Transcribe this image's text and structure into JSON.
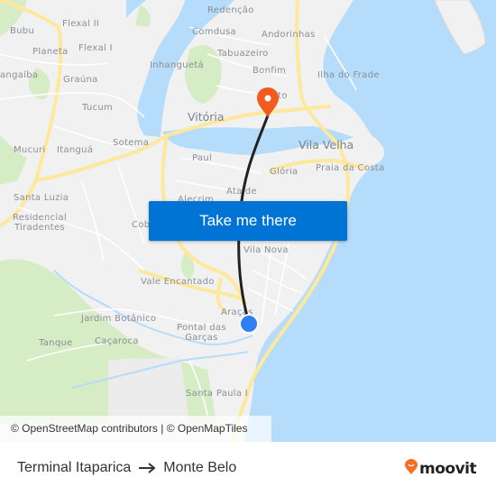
{
  "map": {
    "colors": {
      "land": "#f1f1f1",
      "water": "#b5dcfa",
      "park": "#d6ecc4",
      "major_road": "#fde89c",
      "minor_road": "#ffffff",
      "route_line": "#222222",
      "origin_marker": "#2f7ef3",
      "destination_marker": "#f25a1f"
    },
    "places": [
      {
        "id": "redencao",
        "label": "Redenção"
      },
      {
        "id": "bubu",
        "label": "Bubu"
      },
      {
        "id": "flexal-ii",
        "label": "Flexal II"
      },
      {
        "id": "comdusa",
        "label": "Comdusa"
      },
      {
        "id": "andorinhas",
        "label": "Andorinhas"
      },
      {
        "id": "planeta",
        "label": "Planeta"
      },
      {
        "id": "flexal-i",
        "label": "Flexal I"
      },
      {
        "id": "tabuazeiro",
        "label": "Tabuazeiro"
      },
      {
        "id": "inhangueta",
        "label": "Inhanguetá"
      },
      {
        "id": "bonfim",
        "label": "Bonfim"
      },
      {
        "id": "ilha-do-frade",
        "label": "Ilha do Frade"
      },
      {
        "id": "cangaiba",
        "label": "angaíba"
      },
      {
        "id": "grauna",
        "label": "Graúna"
      },
      {
        "id": "tucum",
        "label": "Tucum"
      },
      {
        "id": "bento",
        "label": "to"
      },
      {
        "id": "vitoria",
        "label": "Vitória"
      },
      {
        "id": "sotema",
        "label": "Sotema"
      },
      {
        "id": "vila-velha",
        "label": "Vila Velha"
      },
      {
        "id": "mucuri",
        "label": "Mucuri"
      },
      {
        "id": "itangua",
        "label": "Itanguá"
      },
      {
        "id": "paul",
        "label": "Paul"
      },
      {
        "id": "gloria",
        "label": "Glória"
      },
      {
        "id": "praia-da-costa",
        "label": "Praia da Costa"
      },
      {
        "id": "santa-luzia",
        "label": "Santa Luzia"
      },
      {
        "id": "ataide",
        "label": "Ataíde"
      },
      {
        "id": "alecrim",
        "label": "Alecrim"
      },
      {
        "id": "residencial-tiradentes",
        "label": "Residencial\nTiradentes"
      },
      {
        "id": "cobi",
        "label": "Cob"
      },
      {
        "id": "vila-nova",
        "label": "Vila Nova"
      },
      {
        "id": "vale-encantado",
        "label": "Vale Encantado"
      },
      {
        "id": "aracas",
        "label": "Araçás"
      },
      {
        "id": "jardim-botanico",
        "label": "Jardim Botânico"
      },
      {
        "id": "pontal-das-garcas",
        "label": "Pontal das\nGarças"
      },
      {
        "id": "tanque",
        "label": "Tanque"
      },
      {
        "id": "cacaroca",
        "label": "Caçaroca"
      },
      {
        "id": "santa-paula",
        "label": "Santa Paula I"
      }
    ],
    "cta_label": "Take me there",
    "attribution": "© OpenStreetMap contributors | © OpenMapTiles"
  },
  "footer": {
    "origin": "Terminal Itaparica",
    "destination": "Monte Belo",
    "brand": "moovit",
    "brand_color": "#f46f24"
  }
}
